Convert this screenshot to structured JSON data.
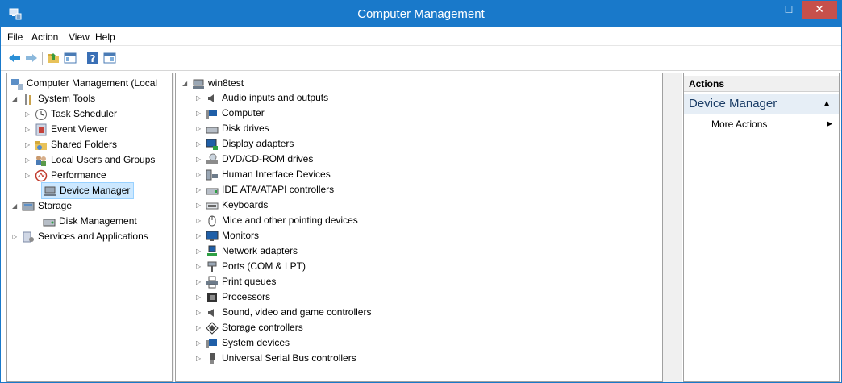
{
  "window": {
    "title": "Computer Management",
    "buttons": {
      "minimize": "–",
      "maximize": "□",
      "close": "✕"
    }
  },
  "menu": {
    "items": [
      "File",
      "Action",
      "View",
      "Help"
    ]
  },
  "toolbar": {
    "icons": [
      "back-arrow-icon",
      "forward-arrow-icon",
      "up-folder-icon",
      "show-hide-console-tree-icon",
      "help-icon",
      "show-hide-action-pane-icon"
    ]
  },
  "left_tree": {
    "root": "Computer Management (Local",
    "system_tools": "System Tools",
    "task_scheduler": "Task Scheduler",
    "event_viewer": "Event Viewer",
    "shared_folders": "Shared Folders",
    "local_users": "Local Users and Groups",
    "performance": "Performance",
    "device_manager": "Device Manager",
    "storage": "Storage",
    "disk_management": "Disk Management",
    "services": "Services and Applications"
  },
  "device_tree": {
    "root": "win8test",
    "items": [
      "Audio inputs and outputs",
      "Computer",
      "Disk drives",
      "Display adapters",
      "DVD/CD-ROM drives",
      "Human Interface Devices",
      "IDE ATA/ATAPI controllers",
      "Keyboards",
      "Mice and other pointing devices",
      "Monitors",
      "Network adapters",
      "Ports (COM & LPT)",
      "Print queues",
      "Processors",
      "Sound, video and game controllers",
      "Storage controllers",
      "System devices",
      "Universal Serial Bus controllers"
    ]
  },
  "actions": {
    "header": "Actions",
    "section": "Device Manager",
    "more_actions": "More Actions"
  },
  "colors": {
    "titlebar": "#1979ca",
    "close_button": "#c7504b",
    "selection": "#cce8ff"
  }
}
